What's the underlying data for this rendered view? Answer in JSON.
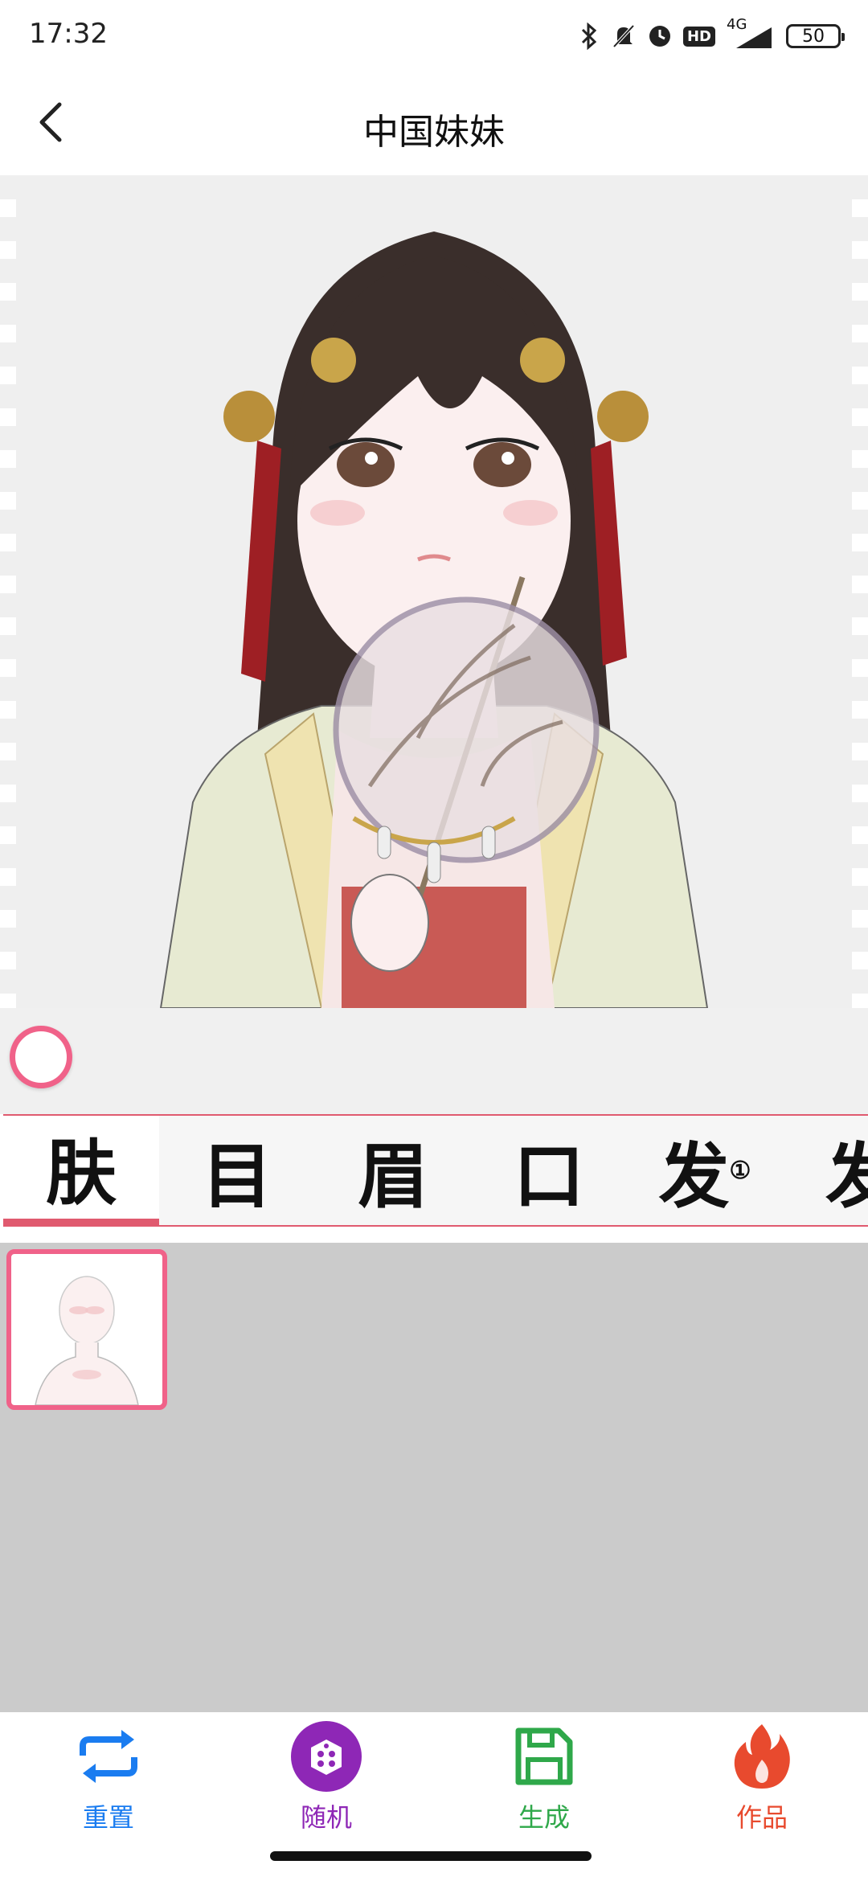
{
  "status_bar": {
    "time": "17:32",
    "network": "4G",
    "hd": "HD",
    "battery": "50"
  },
  "header": {
    "title": "中国妹妹"
  },
  "tabs": [
    {
      "label": "肤",
      "active": true
    },
    {
      "label": "目",
      "active": false
    },
    {
      "label": "眉",
      "active": false
    },
    {
      "label": "口",
      "active": false
    },
    {
      "label": "发",
      "active": false
    },
    {
      "label": "发",
      "active": false
    }
  ],
  "bottom_nav": [
    {
      "label": "重置",
      "icon": "repeat-icon",
      "color": "#1a7cf0"
    },
    {
      "label": "随机",
      "icon": "dice-icon",
      "color": "#8e27b6"
    },
    {
      "label": "生成",
      "icon": "save-icon",
      "color": "#2fa84a"
    },
    {
      "label": "作品",
      "icon": "fire-icon",
      "color": "#e84a2e"
    }
  ],
  "colors": {
    "accent": "#f06289",
    "tab_border": "#e05a6f"
  }
}
